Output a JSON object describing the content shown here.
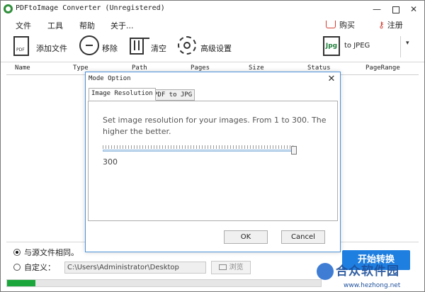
{
  "window": {
    "title": "PDFtoImage Converter (Unregistered)",
    "min_glyph": "—",
    "close_glyph": "✕"
  },
  "menu": {
    "items": [
      "文件",
      "工具",
      "帮助",
      "关于..."
    ],
    "buy_label": "购买",
    "register_label": "注册"
  },
  "toolbar": {
    "add_file_label": "添加文件",
    "pdf_icon_text": "PDF",
    "remove_label": "移除",
    "clear_label": "清空",
    "advanced_label": "高级设置",
    "format_icon_text": "Jpg",
    "format_label": "to JPEG",
    "dropdown_glyph": "▾"
  },
  "table": {
    "columns": [
      "Name",
      "Type",
      "Path",
      "Pages",
      "Size",
      "Status",
      "PageRange"
    ]
  },
  "modal": {
    "title": "Mode Option",
    "close_glyph": "✕",
    "tabs": [
      "Image Resolution",
      "PDF to JPG"
    ],
    "description": "Set image resolution for your images. From 1 to 300.  The higher the better.",
    "slider": {
      "min": 1,
      "max": 300,
      "value": 300
    },
    "value_text": "300",
    "ok_label": "OK",
    "cancel_label": "Cancel"
  },
  "output": {
    "same_as_source_label": "与源文件相同。",
    "custom_label": "自定义：",
    "path_value": "C:\\Users\\Administrator\\Desktop",
    "browse_label": "浏览",
    "same_as_source_selected": true
  },
  "start_label": "开始转换",
  "progress": {
    "value": 0.09
  },
  "watermark": {
    "text": "合众软件园",
    "url": "www.hezhong.net"
  },
  "colors": {
    "accent": "#1f7fe0",
    "progress": "#1aa63a",
    "dialog_border": "#4a90d9"
  }
}
